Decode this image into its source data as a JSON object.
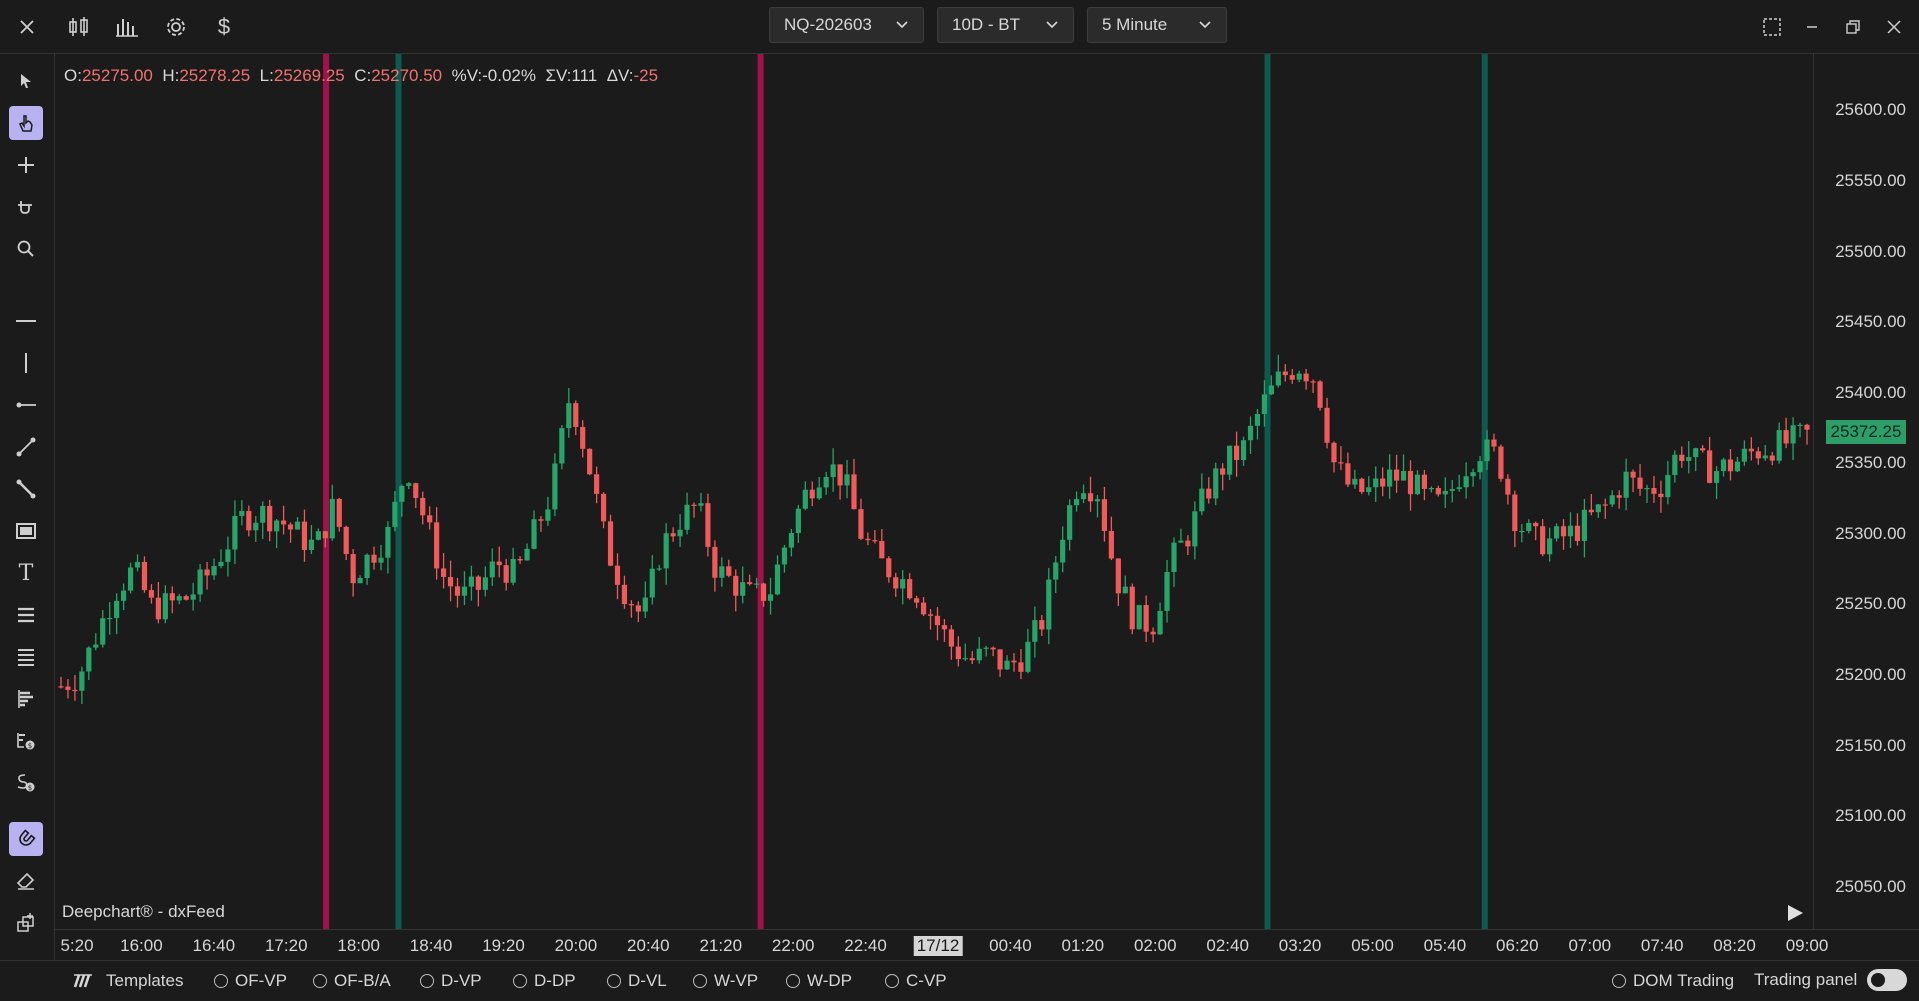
{
  "topbar": {
    "symbol": "NQ-202603",
    "range": "10D - BT",
    "interval": "5 Minute",
    "icons": [
      "close-icon",
      "candlestick-icon",
      "bar-chart-icon",
      "settings-icon",
      "dollar-icon",
      "maximize-icon",
      "minimize-icon",
      "restore-icon",
      "window-close-icon"
    ]
  },
  "ohlc": {
    "o_label": "O:",
    "o_value": "25275.00",
    "h_label": "H:",
    "h_value": "25278.25",
    "l_label": "L:",
    "l_value": "25269.25",
    "c_label": "C:",
    "c_value": "25270.50",
    "pct_label": "%V:",
    "pct_value": "-0.02%",
    "sv_label": "ΣV:",
    "sv_value": "111",
    "dv_label": "ΔV:",
    "dv_value": "-25"
  },
  "last_price": "25372.25",
  "brand": "Deepchart® - dxFeed",
  "colors": {
    "bull": "#26a46a",
    "bear": "#f05a5a",
    "session_red": "#a3114b",
    "session_teal": "#0e5a4f",
    "accent": "#b9b2f0"
  },
  "bottombar": {
    "templates": "Templates",
    "options": [
      "OF-VP",
      "OF-B/A",
      "D-VP",
      "D-DP",
      "D-VL",
      "W-VP",
      "W-DP",
      "C-VP"
    ],
    "dom_trading": "DOM Trading",
    "trading_panel": "Trading panel"
  },
  "chart_data": {
    "type": "candlestick",
    "y_axis_ticks": [
      "25600.00",
      "25550.00",
      "25500.00",
      "25450.00",
      "25400.00",
      "25350.00",
      "25300.00",
      "25250.00",
      "25200.00",
      "25150.00",
      "25100.00",
      "25050.00"
    ],
    "ylim": [
      25020,
      25640
    ],
    "x_axis_ticks": [
      "5:20",
      "16:00",
      "16:40",
      "17:20",
      "18:00",
      "18:40",
      "19:20",
      "20:00",
      "20:40",
      "21:20",
      "22:00",
      "22:40",
      "17/12",
      "00:40",
      "01:20",
      "02:00",
      "02:40",
      "03:20",
      "05:00",
      "05:40",
      "06:20",
      "07:00",
      "07:40",
      "08:20",
      "09:00"
    ],
    "highlighted_x_tick": "17/12",
    "close_path": [
      25192,
      25200,
      25230,
      25260,
      25275,
      25248,
      25250,
      25255,
      25270,
      25290,
      25312,
      25315,
      25310,
      25300,
      25290,
      25320,
      25270,
      25285,
      25300,
      25350,
      25310,
      25270,
      25255,
      25262,
      25280,
      25270,
      25300,
      25330,
      25400,
      25350,
      25290,
      25260,
      25240,
      25290,
      25310,
      25320,
      25275,
      25265,
      25255,
      25260,
      25300,
      25330,
      25350,
      25340,
      25300,
      25280,
      25270,
      25260,
      25240,
      25220,
      25210,
      25215,
      25205,
      25215,
      25240,
      25300,
      25340,
      25330,
      25270,
      25240,
      25235,
      25280,
      25300,
      25330,
      25350,
      25360,
      25390,
      25410,
      25420,
      25410,
      25350,
      25330,
      25330,
      25340,
      25340,
      25325,
      25320,
      25345,
      25360,
      25355,
      25310,
      25295,
      25295,
      25300,
      25310,
      25320,
      25340,
      25330,
      25335,
      25360,
      25350,
      25345,
      25350,
      25358,
      25362,
      25365,
      25370
    ],
    "vertical_session_lines": [
      {
        "color": "red",
        "after_tick": "17:20"
      },
      {
        "color": "teal",
        "after_tick": "18:00"
      },
      {
        "color": "red",
        "after_tick": "21:20"
      },
      {
        "color": "teal",
        "after_tick": "02:40"
      },
      {
        "color": "teal",
        "after_tick": "05:40"
      }
    ]
  }
}
